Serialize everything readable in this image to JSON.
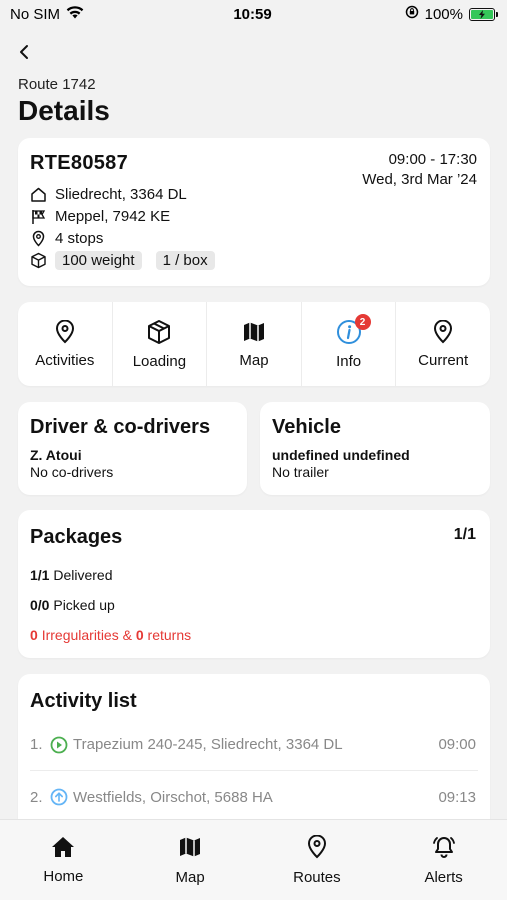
{
  "status_bar": {
    "carrier": "No SIM",
    "time": "10:59",
    "battery": "100%"
  },
  "header": {
    "route_label": "Route 1742",
    "title": "Details"
  },
  "route": {
    "code": "RTE80587",
    "time_range": "09:00 - 17:30",
    "date": "Wed, 3rd Mar ’24",
    "origin": "Sliedrecht, 3364 DL",
    "destination": "Meppel, 7942 KE",
    "stops": "4 stops",
    "tags": [
      "100 weight",
      "1 / box"
    ]
  },
  "actions": [
    {
      "label": "Activities",
      "icon": "map-pin-icon"
    },
    {
      "label": "Loading",
      "icon": "package-icon"
    },
    {
      "label": "Map",
      "icon": "map-icon"
    },
    {
      "label": "Info",
      "icon": "info-icon",
      "badge": "2"
    },
    {
      "label": "Current",
      "icon": "map-pin-icon"
    }
  ],
  "driver": {
    "title": "Driver & co-drivers",
    "name": "Z. Atoui",
    "co_drivers": "No co-drivers"
  },
  "vehicle": {
    "title": "Vehicle",
    "name": "undefined undefined",
    "trailer": "No trailer"
  },
  "packages": {
    "title": "Packages",
    "count": "1/1",
    "delivered_num": "1/1",
    "delivered_label": "Delivered",
    "picked_num": "0/0",
    "picked_label": "Picked up",
    "irregularities_num": "0",
    "irregularities_label": "Irregularities &",
    "returns_num": "0",
    "returns_label": "returns"
  },
  "activity_list": {
    "title": "Activity list",
    "items": [
      {
        "num": "1.",
        "address": "Trapezium 240-245, Sliedrecht, 3364 DL",
        "time": "09:00",
        "icon": "play-circle-icon",
        "color": "#4caf50"
      },
      {
        "num": "2.",
        "address": "Westfields, Oirschot, 5688 HA",
        "time": "09:13",
        "icon": "arrow-up-circle-icon",
        "color": "#64b5f6"
      }
    ]
  },
  "tabbar": [
    {
      "label": "Home",
      "icon": "home-icon"
    },
    {
      "label": "Map",
      "icon": "map-icon"
    },
    {
      "label": "Routes",
      "icon": "map-pin-icon"
    },
    {
      "label": "Alerts",
      "icon": "bell-icon"
    }
  ],
  "colors": {
    "accent_red": "#e53935",
    "info_blue": "#2f8fdc",
    "battery_green": "#34c759"
  }
}
